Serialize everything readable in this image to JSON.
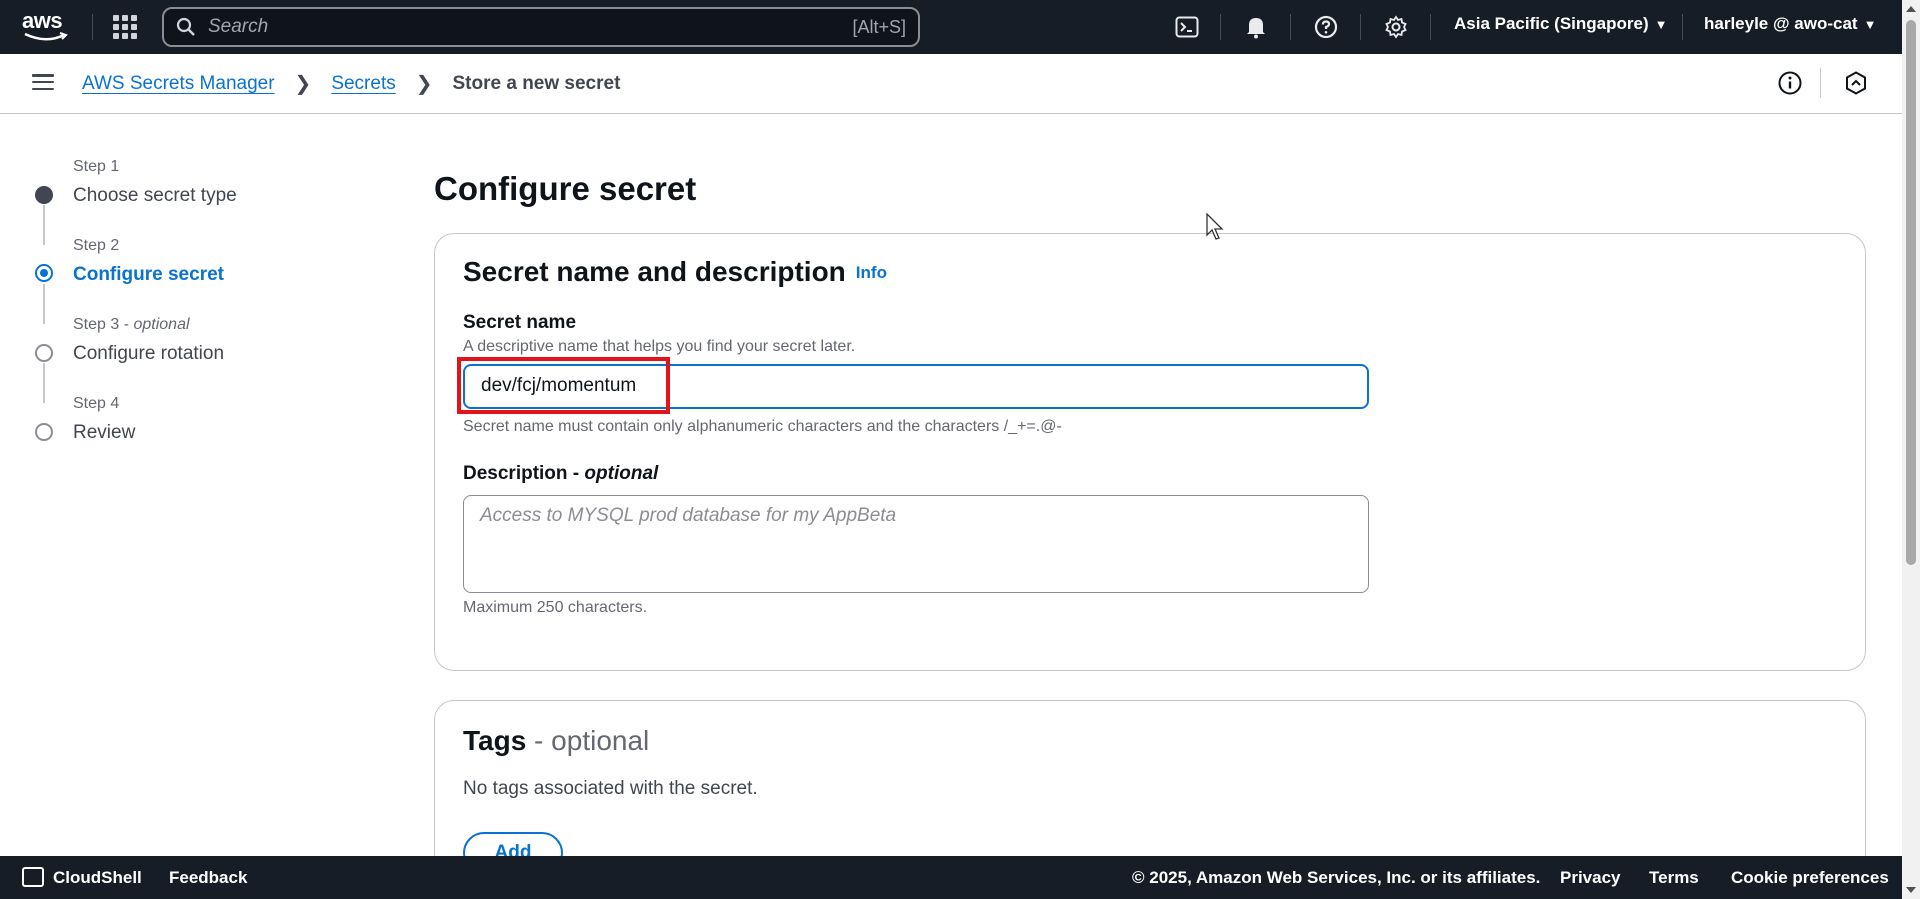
{
  "topnav": {
    "logo_text": "aws",
    "search_placeholder": "Search",
    "search_shortcut": "[Alt+S]",
    "region": "Asia Pacific (Singapore)",
    "user": "harleyle @ awo-cat"
  },
  "breadcrumb": {
    "items": [
      "AWS Secrets Manager",
      "Secrets"
    ],
    "current": "Store a new secret"
  },
  "steps": [
    {
      "label": "Step 1",
      "label_suffix": "",
      "name": "Choose secret type",
      "state": "completed"
    },
    {
      "label": "Step 2",
      "label_suffix": "",
      "name": "Configure secret",
      "state": "active"
    },
    {
      "label": "Step 3",
      "label_suffix": "optional",
      "name": "Configure rotation",
      "state": "pending"
    },
    {
      "label": "Step 4",
      "label_suffix": "",
      "name": "Review",
      "state": "pending"
    }
  ],
  "main": {
    "title": "Configure secret",
    "name_panel": {
      "heading": "Secret name and description",
      "info_link": "Info",
      "secret_name_label": "Secret name",
      "secret_name_desc": "A descriptive name that helps you find your secret later.",
      "secret_name_value": "dev/fcj/momentum",
      "secret_name_constraint": "Secret name must contain only alphanumeric characters and the characters /_+=.@-",
      "description_label": "Description",
      "description_optional": "optional",
      "description_placeholder": "Access to MYSQL prod database for my AppBeta",
      "description_constraint": "Maximum 250 characters."
    },
    "tags_panel": {
      "heading": "Tags",
      "heading_suffix": "optional",
      "empty_text": "No tags associated with the secret.",
      "add_button": "Add"
    }
  },
  "footer": {
    "cloudshell": "CloudShell",
    "feedback": "Feedback",
    "copyright": "© 2025, Amazon Web Services, Inc. or its affiliates.",
    "privacy": "Privacy",
    "terms": "Terms",
    "cookie": "Cookie preferences"
  },
  "colors": {
    "nav_bg": "#161d26",
    "link": "#0972d3",
    "highlight": "#e0141a"
  }
}
